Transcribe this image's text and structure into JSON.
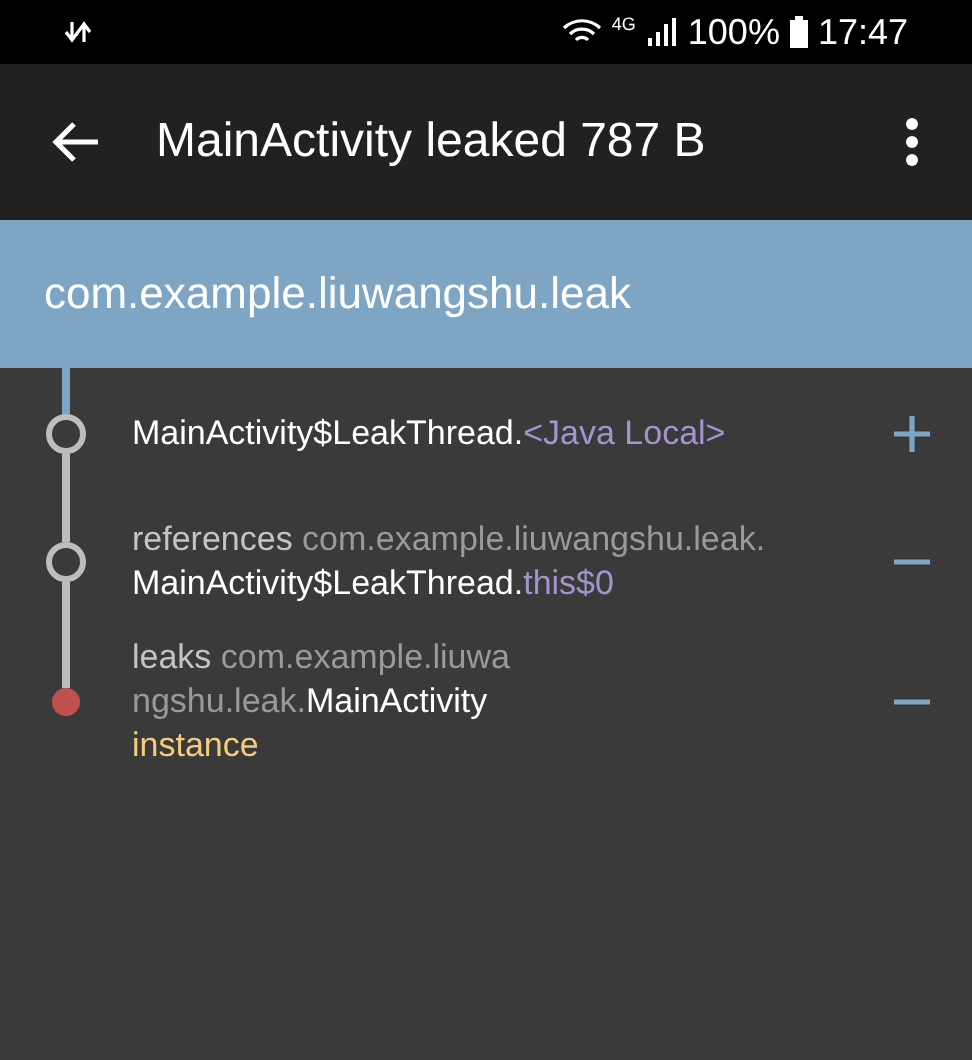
{
  "status_bar": {
    "network": "4G",
    "battery": "100%",
    "time": "17:47"
  },
  "app_bar": {
    "title": "MainActivity leaked 787 B"
  },
  "header": {
    "title": "com.example.liuwangshu.leak"
  },
  "trace": [
    {
      "kind": "reference",
      "expanded": false,
      "lines": [
        [
          {
            "kind": "class",
            "text": "MainActivity$LeakThread."
          },
          {
            "kind": "field",
            "text": "<Java Local>"
          }
        ]
      ]
    },
    {
      "kind": "reference",
      "expanded": true,
      "lines": [
        [
          {
            "kind": "label",
            "text": "references "
          },
          {
            "kind": "package",
            "text": "com.example.liuwangshu.leak."
          }
        ],
        [
          {
            "kind": "class",
            "text": "MainActivity$LeakThread."
          },
          {
            "kind": "field",
            "text": "this$0"
          }
        ]
      ]
    },
    {
      "kind": "leak",
      "expanded": true,
      "lines": [
        [
          {
            "kind": "label",
            "text": "leaks "
          },
          {
            "kind": "package",
            "text": "com.example.liuwa"
          }
        ],
        [
          {
            "kind": "package",
            "text": "ngshu.leak."
          },
          {
            "kind": "class",
            "text": "MainActivity"
          }
        ],
        [
          {
            "kind": "type",
            "text": "instance"
          }
        ]
      ]
    }
  ]
}
